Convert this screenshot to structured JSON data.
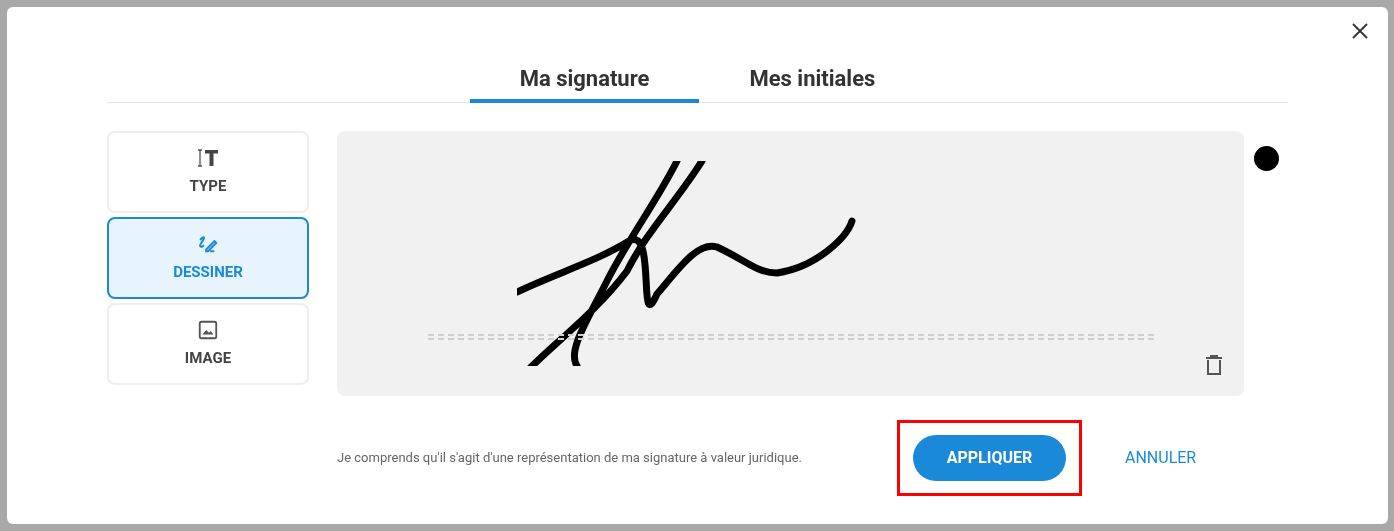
{
  "tabs": [
    {
      "label": "Ma signature",
      "selected": true
    },
    {
      "label": "Mes initiales",
      "selected": false
    }
  ],
  "modes": [
    {
      "kind": "type",
      "label": "TYPE",
      "selected": false
    },
    {
      "kind": "draw",
      "label": "DESSINER",
      "selected": true
    },
    {
      "kind": "image",
      "label": "IMAGE",
      "selected": false
    }
  ],
  "pen_colors": [
    {
      "color": "#000000",
      "selected": true
    }
  ],
  "consent_text": "Je comprends qu'il s'agit d'une représentation de ma signature à valeur juridique.",
  "apply_button": {
    "label": "APPLIQUER",
    "highlighted": true
  },
  "cancel_button": {
    "label": "ANNULER"
  }
}
